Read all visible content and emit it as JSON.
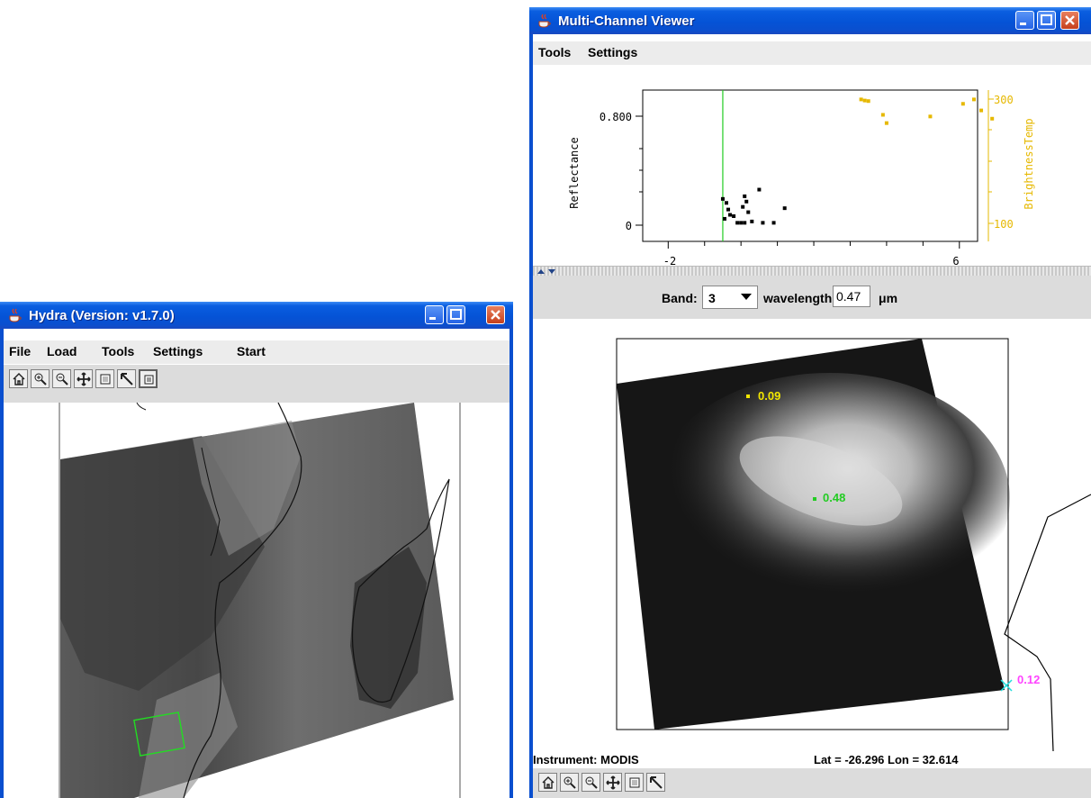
{
  "hydra": {
    "title": "Hydra  (Version: v1.7.0)",
    "menu": [
      "File",
      "Load",
      "Tools",
      "Settings",
      "Start"
    ]
  },
  "viewer": {
    "title": "Multi-Channel Viewer",
    "menu": [
      "Tools",
      "Settings"
    ],
    "band_label": "Band:",
    "band_value": "3",
    "wavelength_label": "wavelength",
    "wavelength_value": "0.47",
    "wavelength_unit": "μm",
    "instrument": "Instrument: MODIS",
    "latlon": "Lat = -26.296  Lon = 32.614",
    "probes": [
      {
        "label": "0.09",
        "color": "#f2e600"
      },
      {
        "label": "0.48",
        "color": "#22cc22"
      },
      {
        "label": "0.12",
        "color": "#ff44ff"
      }
    ]
  },
  "chart_data": {
    "type": "scatter",
    "ylabel": "Reflectance",
    "y2label": "BrightnessTemp",
    "y_ticks": [
      "0.800",
      "0"
    ],
    "y2_ticks": [
      "300",
      "100"
    ],
    "x_ticks": [
      "-2",
      "6"
    ],
    "cursor_x": -0.5,
    "xlim": [
      -2.7,
      6.5
    ],
    "ylim": [
      -0.14,
      1.0
    ],
    "y2lim": [
      40,
      315
    ],
    "reflectance_color": "#000000",
    "brightness_color": "#e6b800",
    "reflectance": [
      [
        -0.5,
        0.18
      ],
      [
        -0.4,
        0.15
      ],
      [
        -0.35,
        0.1
      ],
      [
        -0.3,
        0.06
      ],
      [
        -0.2,
        0.05
      ],
      [
        -0.1,
        0.0
      ],
      [
        0.0,
        0.0
      ],
      [
        0.1,
        0.0
      ],
      [
        0.1,
        0.2
      ],
      [
        0.15,
        0.16
      ],
      [
        0.2,
        0.08
      ],
      [
        0.3,
        0.01
      ],
      [
        0.5,
        0.25
      ],
      [
        0.6,
        0.0
      ],
      [
        0.9,
        0.0
      ],
      [
        1.2,
        0.11
      ],
      [
        -0.45,
        0.03
      ],
      [
        0.05,
        0.12
      ]
    ],
    "brightness": [
      [
        3.3,
        298
      ],
      [
        3.4,
        296
      ],
      [
        3.5,
        295
      ],
      [
        3.9,
        270
      ],
      [
        4.0,
        255
      ],
      [
        5.2,
        267
      ],
      [
        6.1,
        290
      ],
      [
        6.4,
        298
      ],
      [
        6.6,
        278
      ],
      [
        6.9,
        263
      ]
    ]
  }
}
